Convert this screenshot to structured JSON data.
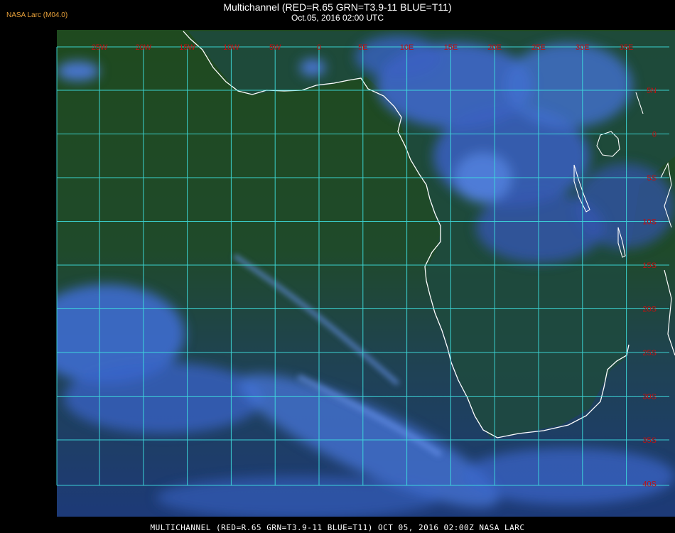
{
  "brand": "NASA Larc (M04.0)",
  "title": "Multichannel (RED=R.65 GRN=T3.9-11 BLUE=T11)",
  "subtitle": "Oct.05, 2016 02:00 UTC",
  "footer": "MULTICHANNEL (RED=R.65 GRN=T3.9-11 BLUE=T11) OCT 05, 2016 02:00Z  NASA LARC",
  "colors": {
    "ocean_north": "#1f4a1f",
    "ocean_south": "#1d3d6e",
    "cloud": "#4a78d8",
    "grid": "#3fe0e0",
    "coast": "#ffffff",
    "label": "#c01010",
    "brand": "#e8a13a"
  },
  "grid": {
    "lon_labels": [
      "25W",
      "20W",
      "15W",
      "10W",
      "5W",
      "0",
      "5E",
      "10E",
      "15E",
      "20E",
      "25E",
      "30E",
      "35E"
    ],
    "lat_labels": [
      "5N",
      "0",
      "5S",
      "10S",
      "15S",
      "20S",
      "25S",
      "30S",
      "35S",
      "40S"
    ]
  }
}
